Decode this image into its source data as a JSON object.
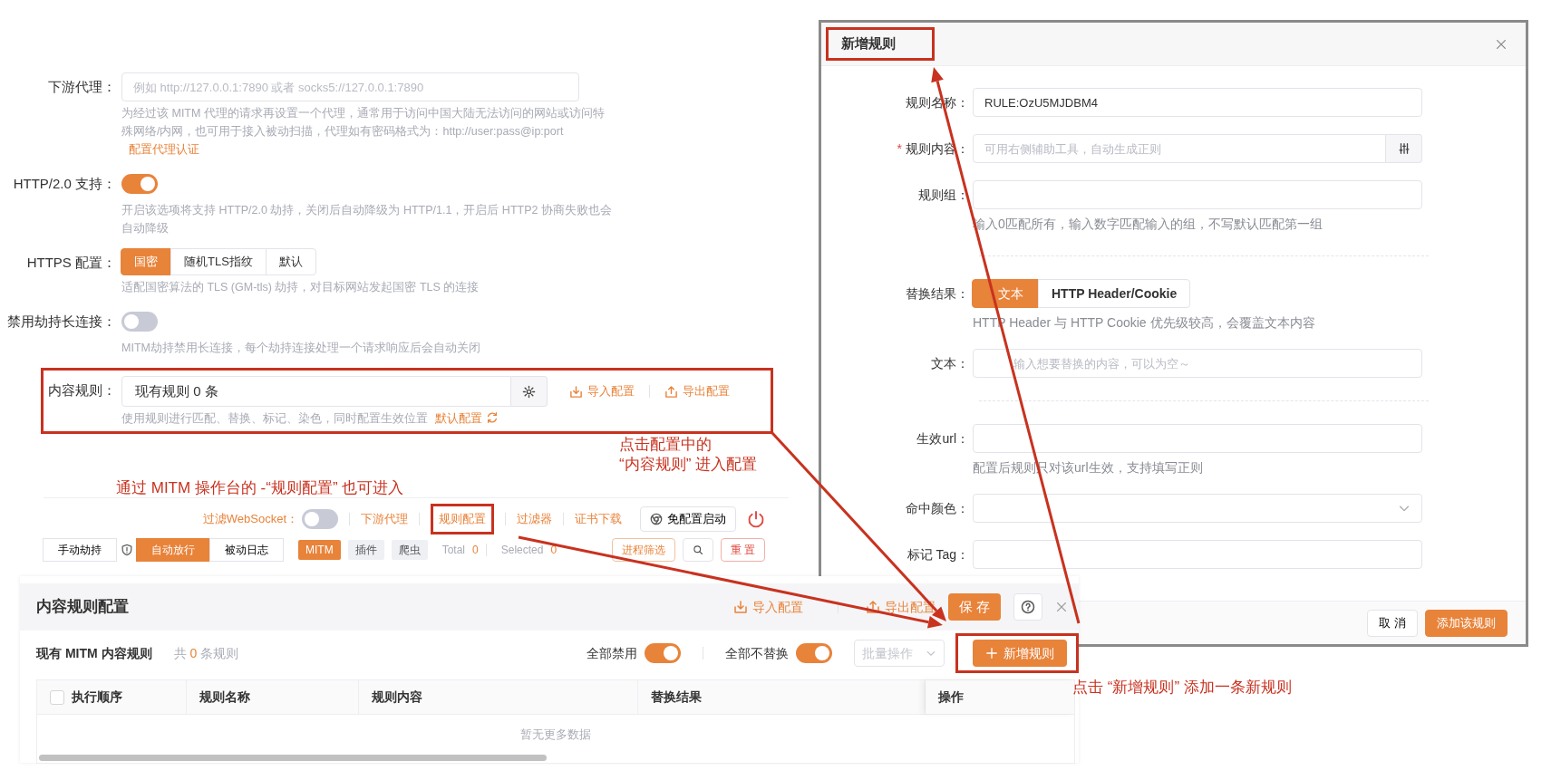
{
  "settings": {
    "rows": [
      {
        "kind": "input",
        "label": "下游代理：",
        "placeholder": "例如 http://127.0.0.1:7890 或者 socks5://127.0.0.1:7890",
        "help": "为经过该 MITM 代理的请求再设置一个代理，通常用于访问中国大陆无法访问的网站或访问特殊网络/内网，也可用于接入被动扫描，代理如有密码格式为：http://user:pass@ip:port",
        "help_link": "配置代理认证"
      },
      {
        "kind": "switch",
        "label": "HTTP/2.0 支持：",
        "on": true,
        "help": "开启该选项将支持 HTTP/2.0 劫持，关闭后自动降级为 HTTP/1.1，开启后 HTTP2 协商失败也会自动降级"
      },
      {
        "kind": "segmented",
        "label": "HTTPS 配置：",
        "options": [
          {
            "label": "国密",
            "selected": true
          },
          {
            "label": "随机TLS指纹",
            "selected": false
          },
          {
            "label": "默认",
            "selected": false
          }
        ],
        "help": "适配国密算法的 TLS (GM-tls) 劫持，对目标网站发起国密 TLS 的连接"
      },
      {
        "kind": "switch",
        "label": "禁用劫持长连接：",
        "on": false,
        "help": "MITM劫持禁用长连接，每个劫持连接处理一个请求响应后会自动关闭"
      },
      {
        "kind": "rules",
        "label": "内容规则：",
        "value": "现有规则 0 条",
        "import": "导入配置",
        "export": "导出配置",
        "help": "使用规则进行匹配、替换、标记、染色，同时配置生效位置",
        "help_link": "默认配置",
        "highlighted": true
      }
    ]
  },
  "console_toolbar": {
    "websocket_filter": {
      "label": "过滤WebSocket：",
      "on": false
    },
    "links": [
      {
        "label": "下游代理",
        "highlighted": false
      },
      {
        "label": "规则配置",
        "highlighted": true
      },
      {
        "label": "过滤器",
        "highlighted": false
      },
      {
        "label": "证书下载",
        "highlighted": false
      }
    ],
    "launch_button": "免配置启动",
    "modes": [
      {
        "label": "手动劫持",
        "selected": false
      },
      {
        "label": "自动放行",
        "selected": true
      },
      {
        "label": "被动日志",
        "selected": false
      }
    ],
    "tags": [
      {
        "label": "MITM",
        "selected": true
      },
      {
        "label": "插件",
        "selected": false
      },
      {
        "label": "爬虫",
        "selected": false
      }
    ],
    "total": {
      "label": "Total",
      "value": "0"
    },
    "selected_count": {
      "label": "Selected",
      "value": "0"
    },
    "process_filter": "进程筛选",
    "reset": "重 置"
  },
  "rules_panel": {
    "title": "内容规则配置",
    "import": "导入配置",
    "export": "导出配置",
    "save": "保 存",
    "subtitle": "现有 MITM 内容规则",
    "count_prefix": "共",
    "count": "0",
    "count_suffix": "条规则",
    "switches": [
      {
        "label": "全部禁用",
        "on": true
      },
      {
        "label": "全部不替换",
        "on": true
      }
    ],
    "batch_placeholder": "批量操作",
    "add_button": "新增规则",
    "add_highlighted": true,
    "select_all_checked": false,
    "columns": [
      "执行顺序",
      "规则名称",
      "规则内容",
      "替换结果",
      "操作"
    ],
    "empty_text": "暂无更多数据"
  },
  "dialog": {
    "title": "新增规则",
    "title_highlighted": true,
    "fields": [
      {
        "kind": "input",
        "label": "规则名称：",
        "value": "RULE:OzU5MJDBM4"
      },
      {
        "kind": "addon",
        "label": "规则内容：",
        "placeholder": "可用右侧辅助工具，自动生成正则",
        "required_mark": "*"
      },
      {
        "kind": "input",
        "label": "规则组：",
        "help": "输入0匹配所有，输入数字匹配输入的组，不写默认匹配第一组"
      },
      {
        "kind": "divider"
      },
      {
        "kind": "segmented",
        "label": "替换结果：",
        "options": [
          {
            "label": "文本",
            "selected": true
          },
          {
            "label": "HTTP Header/Cookie",
            "selected": false
          }
        ],
        "help": "HTTP Header 与 HTTP Cookie 优先级较高，会覆盖文本内容"
      },
      {
        "kind": "input",
        "label": "文本：",
        "placeholder": "输入想要替换的内容，可以为空～"
      },
      {
        "kind": "divider"
      },
      {
        "kind": "input",
        "label": "生效url：",
        "help": "配置后规则只对该url生效，支持填写正则"
      },
      {
        "kind": "select",
        "label": "命中颜色："
      },
      {
        "kind": "input",
        "label": "标记 Tag："
      }
    ],
    "cancel": "取 消",
    "confirm": "添加该规则"
  },
  "annotations": [
    {
      "text": "点击配置中的\n“内容规则” 进入配置"
    },
    {
      "text": "通过 MITM 操作台的 -“规则配置” 也可进入"
    },
    {
      "text": "点击 “新增规则” 添加一条新规则"
    }
  ]
}
